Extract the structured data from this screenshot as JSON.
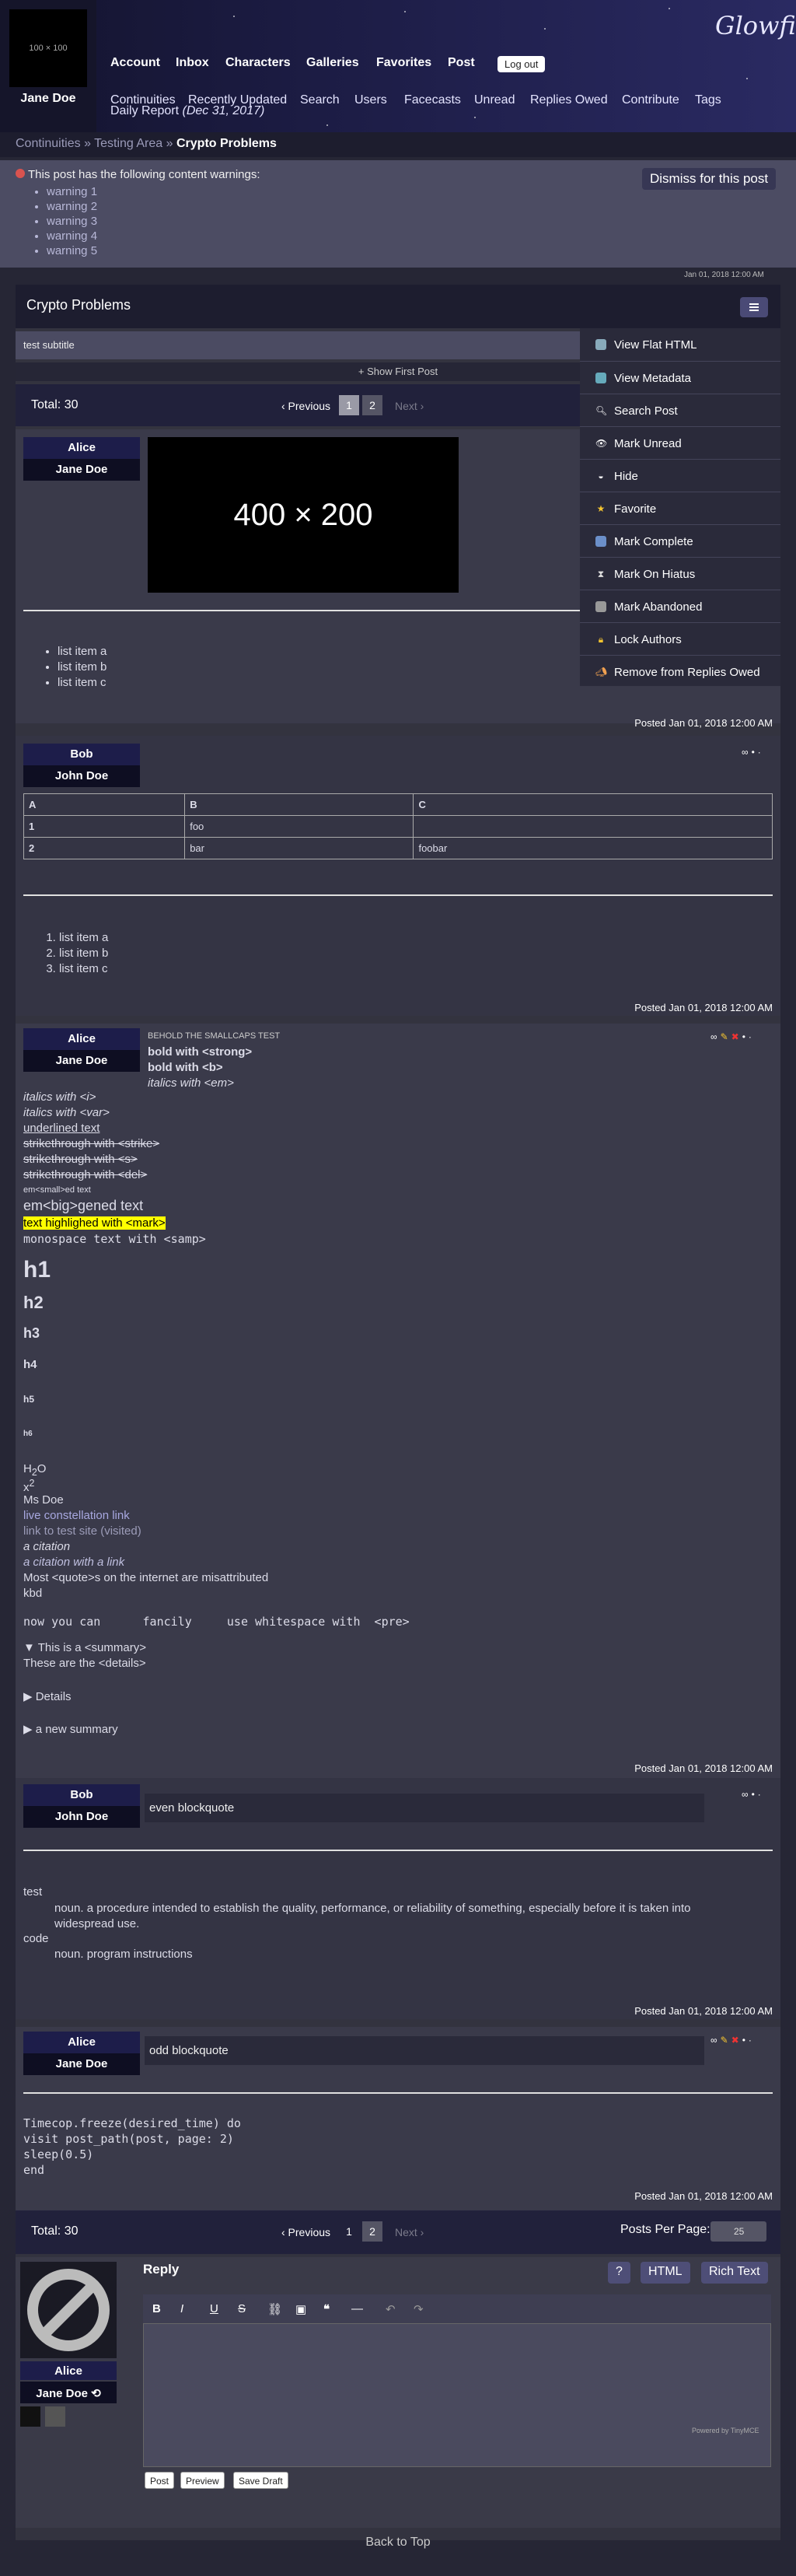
{
  "header": {
    "avatar_placeholder": "100 × 100",
    "username": "Jane Doe",
    "logo": "Glowfic",
    "nav": [
      "Account",
      "Inbox",
      "Characters",
      "Galleries",
      "Favorites",
      "Post"
    ],
    "logout": "Log out",
    "nav2": [
      "Continuities",
      "Recently Updated",
      "Search",
      "Users",
      "Facecasts",
      "Unread",
      "Replies Owed",
      "Contribute",
      "Tags"
    ],
    "daily_report": "Daily Report",
    "daily_date": "(Dec 31, 2017)"
  },
  "breadcrumb": {
    "a": "Continuities",
    "sep": "»",
    "b": "Testing Area",
    "c": "Crypto Problems"
  },
  "warnings": {
    "title": "This post has the following content warnings:",
    "items": [
      "warning 1",
      "warning 2",
      "warning 3",
      "warning 4",
      "warning 5"
    ],
    "dismiss": "Dismiss for this post"
  },
  "top_date": "Jan 01, 2018 12:00 AM",
  "post": {
    "title": "Crypto Problems",
    "subtitle": "test subtitle",
    "show_first": "+ Show First Post"
  },
  "pagination": {
    "total": "Total: 30",
    "prev": "‹ Previous",
    "p1": "1",
    "p2": "2",
    "next": "Next ›",
    "per_page": "Posts Per Page:",
    "per_page_value": "25"
  },
  "menu": [
    "View Flat HTML",
    "View Metadata",
    "Search Post",
    "Mark Unread",
    "Hide",
    "Favorite",
    "Mark Complete",
    "Mark On Hiatus",
    "Mark Abandoned",
    "Lock Authors",
    "Remove from Replies Owed"
  ],
  "replies": [
    {
      "char": "Alice",
      "user": "Jane Doe",
      "image": "400 × 200",
      "list": [
        "list item a",
        "list item b",
        "list item c"
      ],
      "posted": "Posted Jan 01, 2018 12:00 AM"
    },
    {
      "char": "Bob",
      "user": "John Doe",
      "table": {
        "head": [
          "A",
          "B",
          "C"
        ],
        "rows": [
          [
            "1",
            "foo",
            ""
          ],
          [
            "2",
            "bar",
            "foobar"
          ]
        ]
      },
      "list": [
        "list item a",
        "list item b",
        "list item c"
      ],
      "posted": "Posted Jan 01, 2018 12:00 AM"
    },
    {
      "char": "Alice",
      "user": "Jane Doe",
      "smallcaps": "BEHOLD THE SMALLCAPS TEST",
      "strong": "bold with <strong>",
      "b": "bold with <b>",
      "em": "italics with <em>",
      "i": "italics with <i>",
      "var": "italics with <var>",
      "u": "underlined text",
      "strike": "strikethrough with <strike>",
      "s": "strikethrough with <s>",
      "del": "strikethrough with <del>",
      "small": "em<small>ed text",
      "big": "em<big>gened text",
      "mark": "text highlighed with <mark>",
      "samp": "monospace text with <samp>",
      "h1": "h1",
      "h2": "h2",
      "h3": "h3",
      "h4": "h4",
      "h5": "h5",
      "h6": "h6",
      "sub_a": "H",
      "sub_b": "2",
      "sub_c": "O",
      "sup_a": "x",
      "sup_b": "2",
      "abbr": "Ms Doe",
      "link1": "live constellation link",
      "link2": "link to test site (visited)",
      "cite": "a citation",
      "cite2": "a citation with a link",
      "quote": "Most <quote>s on the internet are misattributed",
      "kbd": "kbd",
      "pre": "now you can      fancily     use whitespace with  <pre>",
      "summary1": "This is a <summary>",
      "details1": "These are the <details>",
      "summary2": "Details",
      "summary3": "a new summary",
      "posted": "Posted Jan 01, 2018 12:00 AM"
    },
    {
      "char": "Bob",
      "user": "John Doe",
      "quote": "even blockquote",
      "dl": [
        {
          "dt": "test",
          "dd": "noun. a procedure intended to establish the quality, performance, or reliability of something, especially before it is taken into widespread use."
        },
        {
          "dt": "code",
          "dd": "noun. program instructions"
        }
      ],
      "posted": "Posted Jan 01, 2018 12:00 AM"
    },
    {
      "char": "Alice",
      "user": "Jane Doe",
      "quote": "odd blockquote",
      "code": [
        "Timecop.freeze(desired_time) do",
        "visit post_path(post, page: 2)",
        "sleep(0.5)",
        "end"
      ],
      "posted": "Posted Jan 01, 2018 12:00 AM"
    }
  ],
  "reply_form": {
    "title": "Reply",
    "help": "?",
    "html": "HTML",
    "rich": "Rich Text",
    "char": "Alice",
    "user": "Jane Doe",
    "powered": "Powered by TinyMCE",
    "post": "Post",
    "preview": "Preview",
    "save": "Save Draft"
  },
  "back_top": "Back to Top"
}
